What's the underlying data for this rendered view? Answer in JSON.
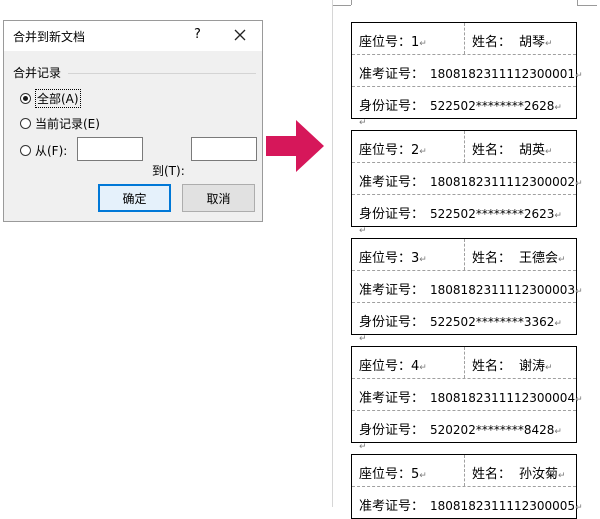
{
  "dialog": {
    "title": "合并到新文档",
    "help": "?",
    "group_title": "合并记录",
    "options": [
      {
        "label": "全部(A)",
        "checked": true
      },
      {
        "label": "当前记录(E)",
        "checked": false
      },
      {
        "label": "从(F):",
        "checked": false
      }
    ],
    "to_label": "到(T):",
    "from_value": "",
    "to_value": "",
    "ok_label": "确定",
    "cancel_label": "取消"
  },
  "arrow_color": "#d6175a",
  "labels": {
    "seat": "座位号：",
    "name": "姓名：",
    "exam_id": "准考证号：",
    "id_card": "身份证号："
  },
  "records": [
    {
      "seat": "1",
      "name": "胡琴",
      "exam_id": "1808182311112300001",
      "id_card": "522502********2628"
    },
    {
      "seat": "2",
      "name": "胡英",
      "exam_id": "1808182311112300002",
      "id_card": "522502********2623"
    },
    {
      "seat": "3",
      "name": "王德会",
      "exam_id": "1808182311112300003",
      "id_card": "522502********3362"
    },
    {
      "seat": "4",
      "name": "谢涛",
      "exam_id": "1808182311112300004",
      "id_card": "520202********8428"
    },
    {
      "seat": "5",
      "name": "孙汝菊",
      "exam_id": "1808182311112300005",
      "id_card": ""
    }
  ],
  "paragraph_mark": "↵"
}
